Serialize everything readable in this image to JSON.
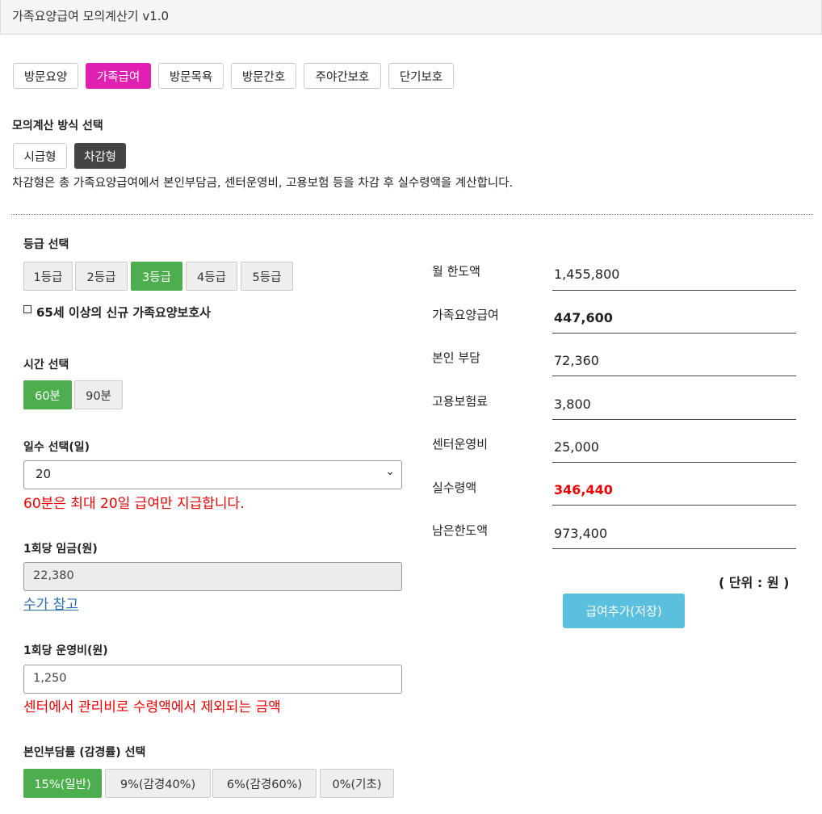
{
  "app": {
    "title": "가족요양급여 모의계산기 v1.0"
  },
  "service_tabs": [
    {
      "label": "방문요양",
      "active": false
    },
    {
      "label": "가족급여",
      "active": true
    },
    {
      "label": "방문목욕",
      "active": false
    },
    {
      "label": "방문간호",
      "active": false
    },
    {
      "label": "주야간보호",
      "active": false
    },
    {
      "label": "단기보호",
      "active": false
    }
  ],
  "mode": {
    "section_label": "모의계산 방식 선택",
    "options": [
      {
        "label": "시급형",
        "active": false
      },
      {
        "label": "차감형",
        "active": true
      }
    ],
    "description": "차감형은 총 가족요양급여에서 본인부담금, 센터운영비, 고용보험 등을 차감 후 실수령액을 계산합니다."
  },
  "grade": {
    "section_label": "등급 선택",
    "options": [
      {
        "label": "1등급",
        "active": false
      },
      {
        "label": "2등급",
        "active": false
      },
      {
        "label": "3등급",
        "active": true
      },
      {
        "label": "4등급",
        "active": false
      },
      {
        "label": "5등급",
        "active": false
      }
    ],
    "checkbox_label": "65세 이상의 신규 가족요양보호사",
    "checkbox_checked": false
  },
  "time": {
    "section_label": "시간 선택",
    "options": [
      {
        "label": "60분",
        "active": true
      },
      {
        "label": "90분",
        "active": false
      }
    ]
  },
  "days": {
    "section_label": "일수 선택(일)",
    "value": "20",
    "warning": "60분은 최대 20일 급여만 지급합니다."
  },
  "wage": {
    "section_label": "1회당 임금(원)",
    "value": "22,380",
    "link": "수가 참고"
  },
  "operating_cost": {
    "section_label": "1회당 운영비(원)",
    "value": "1,250",
    "warning": "센터에서 관리비로 수령액에서 제외되는 금액"
  },
  "copay": {
    "section_label": "본인부담률 (감경률) 선택",
    "options": [
      {
        "label": "15%(일반)",
        "active": true
      },
      {
        "label": "9%(감경40%)",
        "active": false
      },
      {
        "label": "6%(감경60%)",
        "active": false
      },
      {
        "label": "0%(기초)",
        "active": false
      }
    ]
  },
  "results": [
    {
      "label": "월 한도액",
      "value": "1,455,800"
    },
    {
      "label": "가족요양급여",
      "value": "447,600"
    },
    {
      "label": "본인 부담",
      "value": "72,360"
    },
    {
      "label": "고용보험료",
      "value": "3,800"
    },
    {
      "label": "센터운영비",
      "value": "25,000"
    },
    {
      "label": "실수령액",
      "value": "346,440"
    },
    {
      "label": "남은한도액",
      "value": "973,400"
    }
  ],
  "unit_note": "( 단위 : 원 )",
  "save_button": "급여추가(저장)",
  "colors": {
    "accent_tab": "#e020b0",
    "active_green": "#4cae4c",
    "warning_red": "#e00000",
    "save_blue": "#5bc0de"
  }
}
